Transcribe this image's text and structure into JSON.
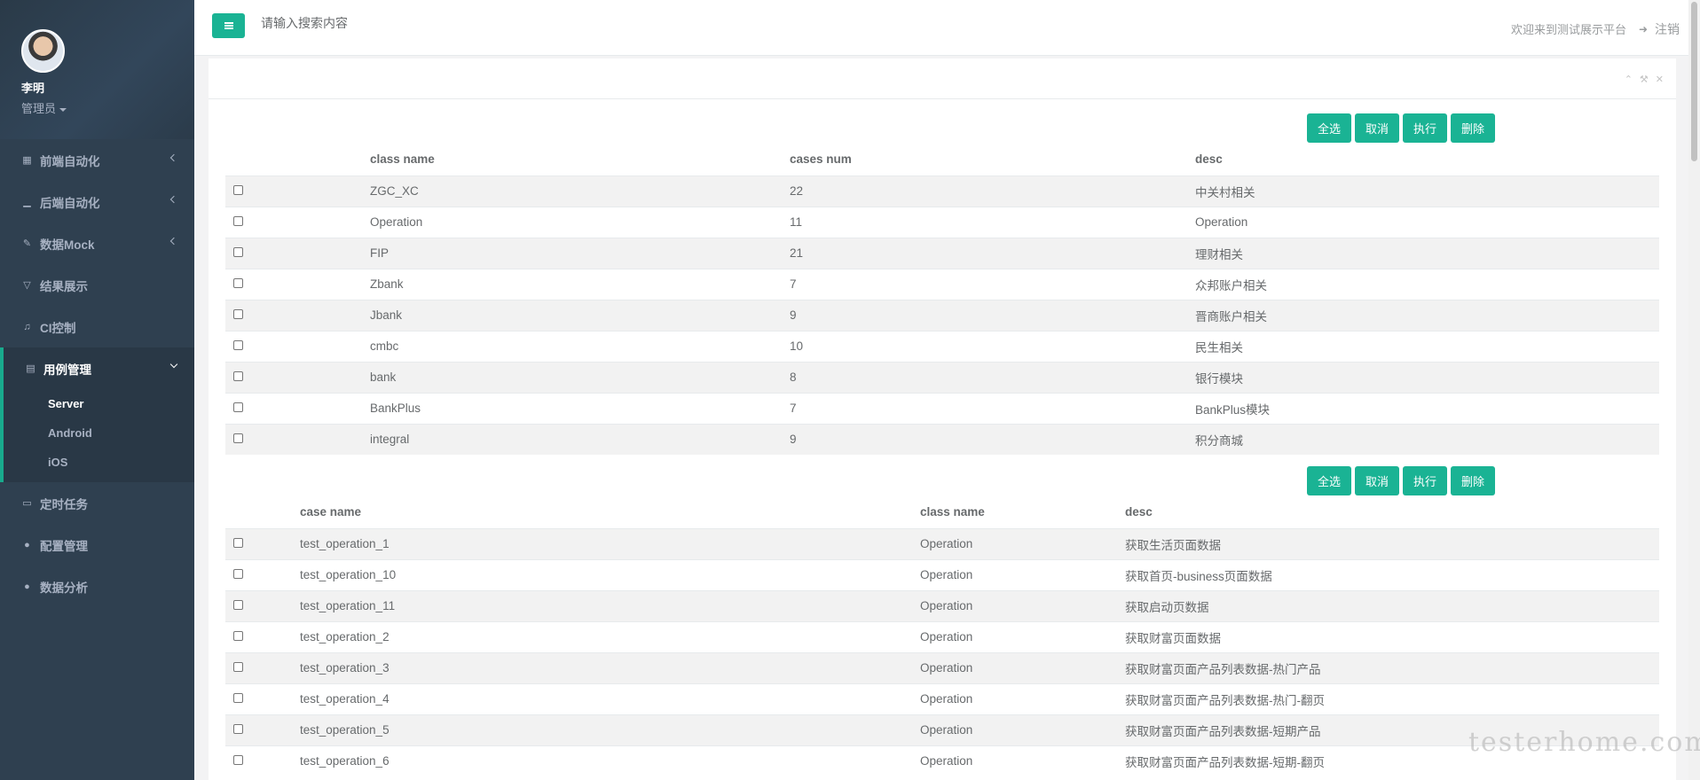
{
  "profile": {
    "name": "李明",
    "role": "管理员"
  },
  "nav": [
    {
      "label": "前端自动化",
      "icon": "grid-icon"
    },
    {
      "label": "后端自动化",
      "icon": "bar-chart-icon"
    },
    {
      "label": "数据Mock",
      "icon": "edit-icon"
    },
    {
      "label": "结果展示",
      "icon": "filter-icon"
    },
    {
      "label": "CI控制",
      "icon": "music-icon"
    }
  ],
  "nav_active": {
    "label": "用例管理",
    "icon": "database-icon",
    "children": [
      {
        "label": "Server"
      },
      {
        "label": "Android"
      },
      {
        "label": "iOS"
      }
    ]
  },
  "nav_bottom": [
    {
      "label": "定时任务",
      "icon": "desktop-icon"
    },
    {
      "label": "配置管理",
      "icon": "globe-icon"
    },
    {
      "label": "数据分析",
      "icon": "globe-icon"
    }
  ],
  "header": {
    "search_placeholder": "请输入搜索内容",
    "welcome": "欢迎来到测试展示平台",
    "logout": "注销"
  },
  "actions": {
    "select_all": "全选",
    "cancel": "取消",
    "execute": "执行",
    "delete": "删除"
  },
  "class_table": {
    "headers": [
      "class name",
      "cases num",
      "desc"
    ],
    "rows": [
      [
        "ZGC_XC",
        "22",
        "中关村相关"
      ],
      [
        "Operation",
        "11",
        "Operation"
      ],
      [
        "FIP",
        "21",
        "理财相关"
      ],
      [
        "Zbank",
        "7",
        "众邦账户相关"
      ],
      [
        "Jbank",
        "9",
        "晋商账户相关"
      ],
      [
        "cmbc",
        "10",
        "民生相关"
      ],
      [
        "bank",
        "8",
        "银行模块"
      ],
      [
        "BankPlus",
        "7",
        "BankPlus模块"
      ],
      [
        "integral",
        "9",
        "积分商城"
      ]
    ]
  },
  "case_table": {
    "headers": [
      "case name",
      "class name",
      "desc"
    ],
    "rows": [
      [
        "test_operation_1",
        "Operation",
        "获取生活页面数据"
      ],
      [
        "test_operation_10",
        "Operation",
        "获取首页-business页面数据"
      ],
      [
        "test_operation_11",
        "Operation",
        "获取启动页数据"
      ],
      [
        "test_operation_2",
        "Operation",
        "获取财富页面数据"
      ],
      [
        "test_operation_3",
        "Operation",
        "获取财富页面产品列表数据-热门产品"
      ],
      [
        "test_operation_4",
        "Operation",
        "获取财富页面产品列表数据-热门-翻页"
      ],
      [
        "test_operation_5",
        "Operation",
        "获取财富页面产品列表数据-短期产品"
      ],
      [
        "test_operation_6",
        "Operation",
        "获取财富页面产品列表数据-短期-翻页"
      ]
    ]
  },
  "watermark": "testerhome.com"
}
